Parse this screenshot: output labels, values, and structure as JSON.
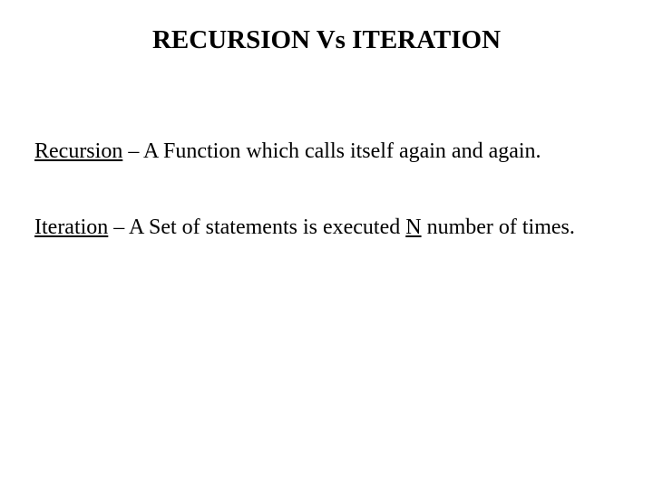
{
  "title": "RECURSION Vs ITERATION",
  "definitions": {
    "recursion": {
      "term": "Recursion",
      "desc": " – A Function which calls itself again and again."
    },
    "iteration": {
      "term": "Iteration",
      "desc_before": " – A Set of statements is executed ",
      "n": "N",
      "desc_after": " number of times."
    }
  }
}
